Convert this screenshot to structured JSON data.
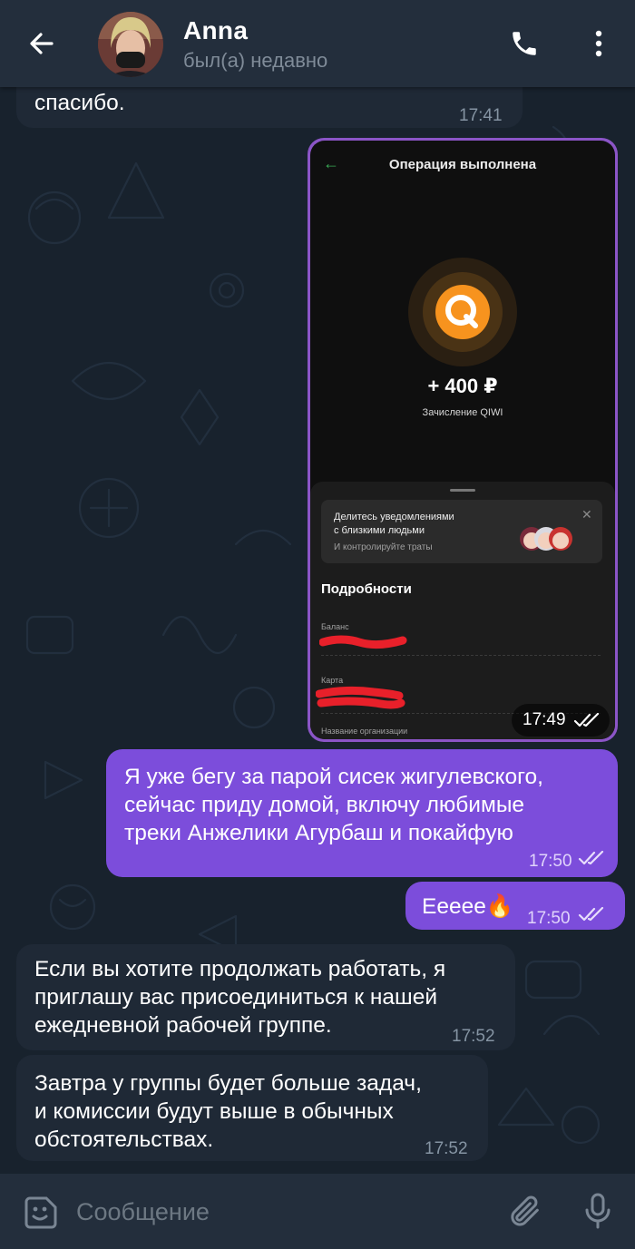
{
  "header": {
    "name": "Anna",
    "status": "был(а) недавно",
    "icons": [
      "back-arrow-icon",
      "phone-icon",
      "more-vertical-icon"
    ]
  },
  "messages": [
    {
      "text": "спасибо.",
      "time": "17:41",
      "direction": "incoming"
    },
    {
      "type": "image",
      "time": "17:49",
      "direction": "outgoing",
      "read": true,
      "screenshot": {
        "title": "Операция выполнена",
        "amount": "+ 400 ₽",
        "subtitle": "Зачисление QIWI",
        "promo_line1": "Делитесь уведомлениями",
        "promo_line2": "с близкими людьми",
        "promo_line3": "И контролируйте траты",
        "details_title": "Подробности",
        "label_balance": "Баланс",
        "label_card": "Карта",
        "label_org": "Название организации"
      }
    },
    {
      "text": "Я уже бегу за парой сисек жигулевского,\nсейчас приду домой, включу любимые\nтреки Анжелики Агурбаш и покайфую",
      "time": "17:50",
      "direction": "outgoing",
      "read": true
    },
    {
      "text": "Ееeee🔥",
      "time": "17:50",
      "direction": "outgoing",
      "read": true
    },
    {
      "text": "Если вы хотите продолжать работать, я\nприглашу вас присоединиться к нашей\nежедневной рабочей группе.",
      "time": "17:52",
      "direction": "incoming"
    },
    {
      "text": "Завтра у группы будет больше задач,\nи комиссии будут выше в обычных\nобстоятельствах.",
      "time": "17:52",
      "direction": "incoming"
    }
  ],
  "input": {
    "placeholder": "Сообщение",
    "value": "",
    "icons": [
      "sticker-icon",
      "paperclip-icon",
      "microphone-icon"
    ]
  },
  "colors": {
    "header_bg": "#232e3c",
    "chat_bg": "#18222d",
    "incoming_bubble": "#1f2936",
    "outgoing_bubble": "#7c4ddb",
    "qiwi_orange": "#f7931e"
  }
}
